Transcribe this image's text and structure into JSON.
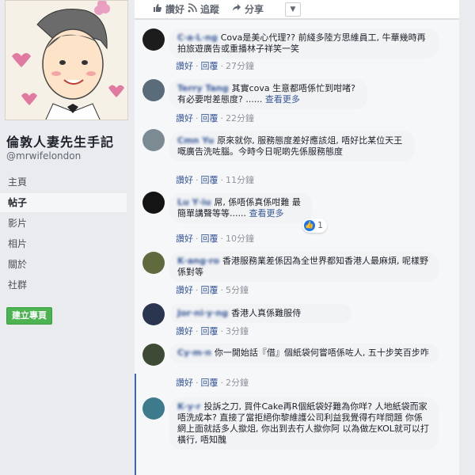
{
  "sidebar": {
    "page_name": "倫敦人妻先生手記",
    "handle": "@mrwifelondon",
    "nav": [
      {
        "label": "主頁",
        "active": false
      },
      {
        "label": "帖子",
        "active": true
      },
      {
        "label": "影片",
        "active": false
      },
      {
        "label": "相片",
        "active": false
      },
      {
        "label": "關於",
        "active": false
      },
      {
        "label": "社群",
        "active": false
      }
    ],
    "create_page_label": "建立專頁"
  },
  "actions": {
    "like_label": "讚好",
    "follow_label": "追蹤",
    "share_label": "分享",
    "more_label": "▼"
  },
  "meta_labels": {
    "like": "讚好",
    "reply": "回覆"
  },
  "comments": [
    {
      "name": "C·a·L·ng",
      "text": "Cova是美心代理?? 前綫多陸方思維員工, 牛華幾時再拍旅遊廣告或重播林子祥笑一笑",
      "see_more": "",
      "time": "27分鐘",
      "avatar_color": "#1c1c1c"
    },
    {
      "name": "Terry Tang",
      "text": "其實cova 生意都唔係忙到咁啫?有必要咁差態度? ......",
      "see_more": "查看更多",
      "time": "22分鐘",
      "avatar_color": "#5a6b7a"
    },
    {
      "name": "Cmn Yu",
      "text": "原來就你, 服務態度差好應該俎, 唔好比某位天王嘅廣告洗咗腦。今時今日呢啲先係服務態度",
      "see_more": "",
      "time": "11分鐘",
      "avatar_color": "#7c8a94"
    },
    {
      "name": "Lu Y·iu",
      "text": "屌, 係唔係真係咁難 最簡單講聲等等......",
      "see_more": "查看更多",
      "time": "10分鐘",
      "avatar_color": "#141414",
      "reaction_count": "1"
    },
    {
      "name": "K·ang·ro",
      "text": "香港服務業差係因為全世界都知香港人最麻煩, 呢樣野係對等",
      "see_more": "",
      "time": "5分鐘",
      "avatar_color": "#5f6b3e"
    },
    {
      "name": "Jor·ni·y·ng",
      "text": "香港人真係難服侍",
      "see_more": "",
      "time": "3分鐘",
      "avatar_color": "#2a3550"
    },
    {
      "name": "Cy·m·n",
      "text": "你一開始話『借』個紙袋何嘗唔係咗人, 五十步笑百步咋",
      "see_more": "",
      "time": "2分鐘",
      "avatar_color": "#3e4a36"
    },
    {
      "name": "K·y·r",
      "text": "投訴之刀, 買件Cake再R個紙袋好難為你咩? 人地紙袋而家唔洗成本? 直接了當拒絕你黎維護公司利益我覺得冇咩問題 你係網上面就話多人撳俎, 你出到去冇人撳你阿 以為做左KOL就可以打橫行, 唔知醜",
      "see_more": "",
      "time": "",
      "avatar_color": "#3d7a8c"
    }
  ],
  "colors": {
    "link": "#385898",
    "create_button": "#4bb34f",
    "like_reaction": "#1877f2"
  }
}
